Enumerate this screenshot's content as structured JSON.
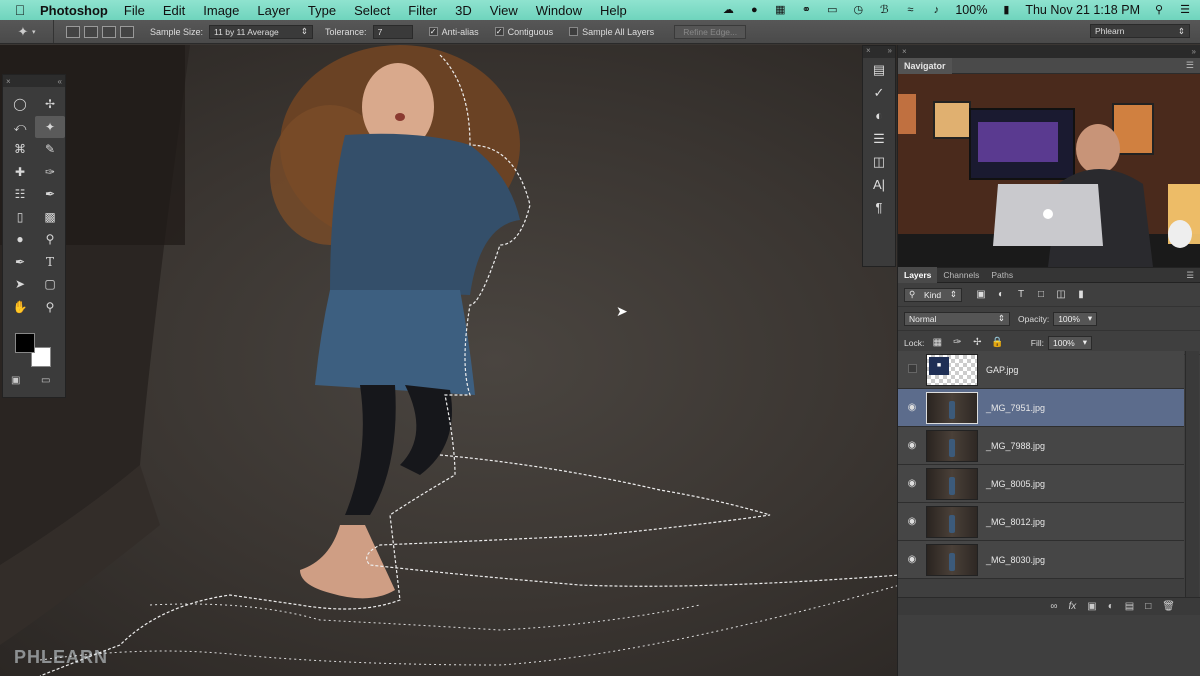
{
  "menubar": {
    "app_name": "Photoshop",
    "items": [
      "File",
      "Edit",
      "Image",
      "Layer",
      "Type",
      "Select",
      "Filter",
      "3D",
      "View",
      "Window",
      "Help"
    ],
    "battery": "100%",
    "clock": "Thu Nov 21  1:18 PM"
  },
  "options": {
    "sample_size_label": "Sample Size:",
    "sample_size_value": "11 by 11 Average",
    "tolerance_label": "Tolerance:",
    "tolerance_value": "7",
    "anti_alias_label": "Anti-alias",
    "anti_alias_checked": true,
    "contiguous_label": "Contiguous",
    "contiguous_checked": true,
    "sample_all_label": "Sample All Layers",
    "sample_all_checked": false,
    "refine_edge_label": "Refine Edge...",
    "workspace": "Phlearn"
  },
  "navigator": {
    "title": "Navigator"
  },
  "layers_panel": {
    "tabs": [
      "Layers",
      "Channels",
      "Paths"
    ],
    "filter_kind": "Kind",
    "blend_mode": "Normal",
    "opacity_label": "Opacity:",
    "opacity_value": "100%",
    "lock_label": "Lock:",
    "fill_label": "Fill:",
    "fill_value": "100%",
    "layers": [
      {
        "name": "GAP.jpg",
        "visible": false,
        "selected": false,
        "thumb": "gap"
      },
      {
        "name": "_MG_7951.jpg",
        "visible": true,
        "selected": true,
        "thumb": "photo"
      },
      {
        "name": "_MG_7988.jpg",
        "visible": true,
        "selected": false,
        "thumb": "photo"
      },
      {
        "name": "_MG_8005.jpg",
        "visible": true,
        "selected": false,
        "thumb": "photo"
      },
      {
        "name": "_MG_8012.jpg",
        "visible": true,
        "selected": false,
        "thumb": "photo"
      },
      {
        "name": "_MG_8030.jpg",
        "visible": true,
        "selected": false,
        "thumb": "photo"
      }
    ],
    "gap_logo_text": "GAP"
  },
  "watermark": "PHLEARN",
  "colors": {
    "menubar": "#7fdcc6",
    "selection_highlight": "#5c6c8c",
    "panel": "#3f3f3f"
  }
}
